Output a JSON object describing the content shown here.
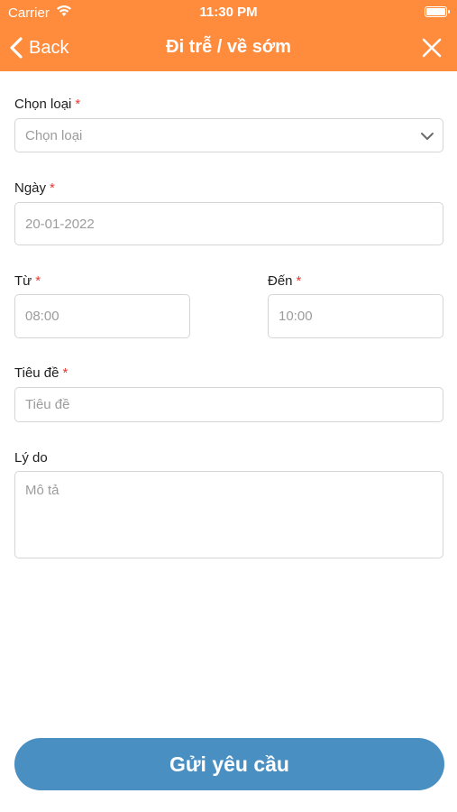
{
  "status_bar": {
    "carrier": "Carrier",
    "time": "11:30 PM"
  },
  "nav": {
    "back_label": "Back",
    "title": "Đi trễ / về sớm"
  },
  "form": {
    "type": {
      "label": "Chọn loại",
      "required_mark": "*",
      "placeholder": "Chọn loại"
    },
    "date": {
      "label": "Ngày",
      "required_mark": "*",
      "value": "20-01-2022"
    },
    "from": {
      "label": "Từ",
      "required_mark": "*",
      "value": "08:00"
    },
    "to": {
      "label": "Đến",
      "required_mark": "*",
      "value": "10:00"
    },
    "subject": {
      "label": "Tiêu đề",
      "required_mark": "*",
      "placeholder": "Tiêu đề"
    },
    "reason": {
      "label": "Lý do",
      "placeholder": "Mô tả"
    }
  },
  "submit_label": "Gửi yêu cầu",
  "colors": {
    "header": "#ff8b3d",
    "button": "#4a8fc2",
    "required": "#e53935"
  },
  "icons": {
    "back": "chevron-left-icon",
    "close": "close-icon",
    "dropdown": "chevron-down-icon",
    "wifi": "wifi-icon",
    "battery": "battery-icon"
  }
}
